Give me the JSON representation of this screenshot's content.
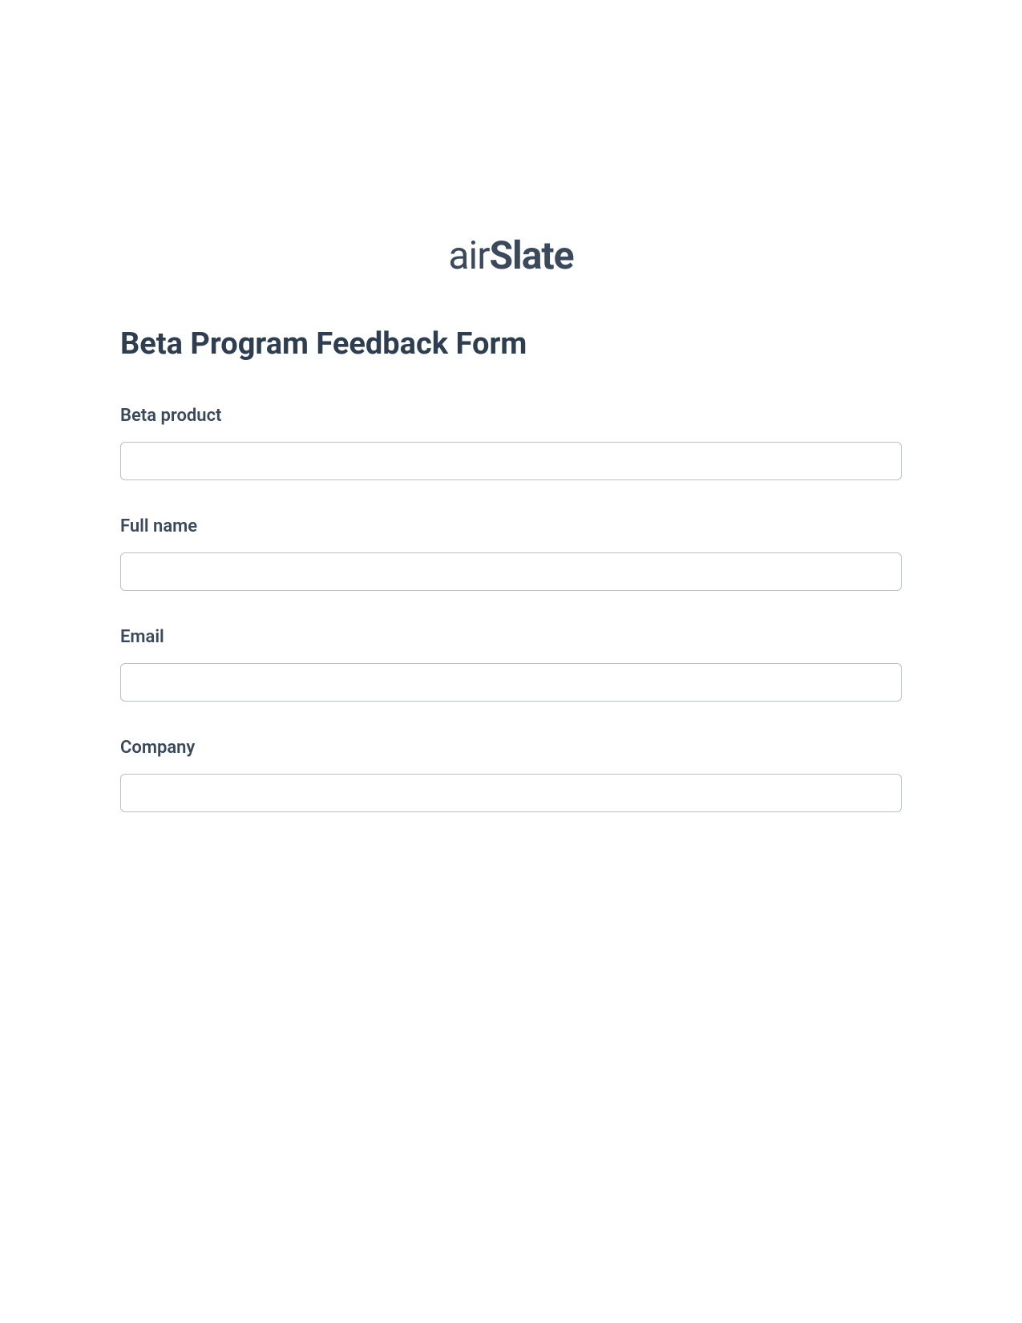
{
  "logo": {
    "prefix": "air",
    "suffix": "Slate"
  },
  "form": {
    "title": "Beta Program Feedback Form",
    "fields": [
      {
        "label": "Beta product",
        "value": ""
      },
      {
        "label": "Full name",
        "value": ""
      },
      {
        "label": "Email",
        "value": ""
      },
      {
        "label": "Company",
        "value": ""
      }
    ]
  }
}
